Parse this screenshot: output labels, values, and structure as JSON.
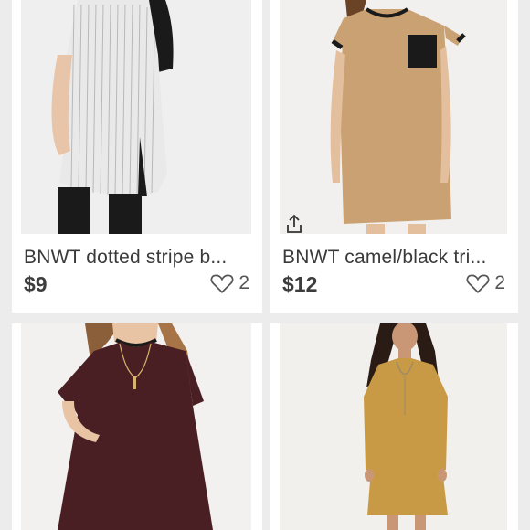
{
  "listings": [
    {
      "title": "BNWT dotted stripe b...",
      "price": "$9",
      "likes": "2",
      "heart_icon": "heart-outline-icon"
    },
    {
      "title": "BNWT camel/black tri...",
      "price": "$12",
      "likes": "2",
      "heart_icon": "heart-outline-icon",
      "share_icon": "share-icon"
    },
    {
      "title": "",
      "price": "",
      "likes": ""
    },
    {
      "title": "",
      "price": "",
      "likes": ""
    }
  ],
  "colors": {
    "background": "#ececec",
    "card": "#ffffff",
    "text": "#3a3a3a",
    "camel": "#c9a172",
    "burgundy": "#4a1f24",
    "mustard": "#c99a45"
  }
}
